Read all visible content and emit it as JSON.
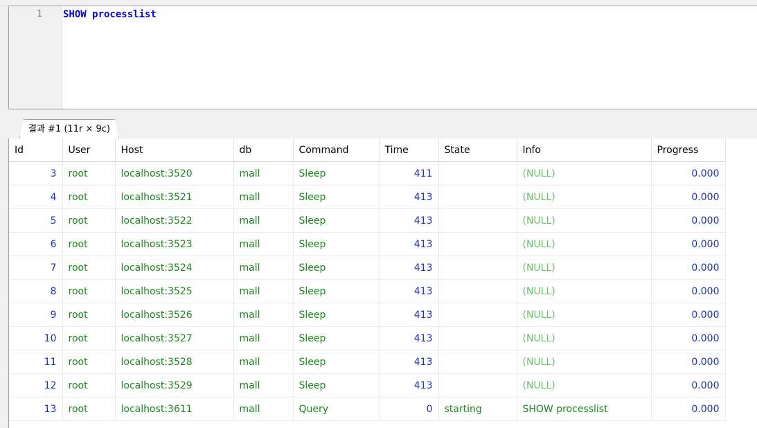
{
  "editor": {
    "line_number": "1",
    "query": "SHOW processlist"
  },
  "results": {
    "tab_label": "결과 #1 (11r × 9c)",
    "columns": [
      "Id",
      "User",
      "Host",
      "db",
      "Command",
      "Time",
      "State",
      "Info",
      "Progress"
    ],
    "rows": [
      {
        "id": "3",
        "user": "root",
        "host": "localhost:3520",
        "db": "mall",
        "command": "Sleep",
        "time": "411",
        "state": "",
        "info": "(NULL)",
        "progress": "0.000"
      },
      {
        "id": "4",
        "user": "root",
        "host": "localhost:3521",
        "db": "mall",
        "command": "Sleep",
        "time": "413",
        "state": "",
        "info": "(NULL)",
        "progress": "0.000"
      },
      {
        "id": "5",
        "user": "root",
        "host": "localhost:3522",
        "db": "mall",
        "command": "Sleep",
        "time": "413",
        "state": "",
        "info": "(NULL)",
        "progress": "0.000"
      },
      {
        "id": "6",
        "user": "root",
        "host": "localhost:3523",
        "db": "mall",
        "command": "Sleep",
        "time": "413",
        "state": "",
        "info": "(NULL)",
        "progress": "0.000"
      },
      {
        "id": "7",
        "user": "root",
        "host": "localhost:3524",
        "db": "mall",
        "command": "Sleep",
        "time": "413",
        "state": "",
        "info": "(NULL)",
        "progress": "0.000"
      },
      {
        "id": "8",
        "user": "root",
        "host": "localhost:3525",
        "db": "mall",
        "command": "Sleep",
        "time": "413",
        "state": "",
        "info": "(NULL)",
        "progress": "0.000"
      },
      {
        "id": "9",
        "user": "root",
        "host": "localhost:3526",
        "db": "mall",
        "command": "Sleep",
        "time": "413",
        "state": "",
        "info": "(NULL)",
        "progress": "0.000"
      },
      {
        "id": "10",
        "user": "root",
        "host": "localhost:3527",
        "db": "mall",
        "command": "Sleep",
        "time": "413",
        "state": "",
        "info": "(NULL)",
        "progress": "0.000"
      },
      {
        "id": "11",
        "user": "root",
        "host": "localhost:3528",
        "db": "mall",
        "command": "Sleep",
        "time": "413",
        "state": "",
        "info": "(NULL)",
        "progress": "0.000"
      },
      {
        "id": "12",
        "user": "root",
        "host": "localhost:3529",
        "db": "mall",
        "command": "Sleep",
        "time": "413",
        "state": "",
        "info": "(NULL)",
        "progress": "0.000"
      },
      {
        "id": "13",
        "user": "root",
        "host": "localhost:3611",
        "db": "mall",
        "command": "Query",
        "time": "0",
        "state": "starting",
        "info": "SHOW processlist",
        "progress": "0.000"
      }
    ]
  },
  "colors": {
    "keyword": "#0000ff",
    "number": "#1a2fd4",
    "text": "#1a8a1a",
    "null": "#66c266"
  }
}
